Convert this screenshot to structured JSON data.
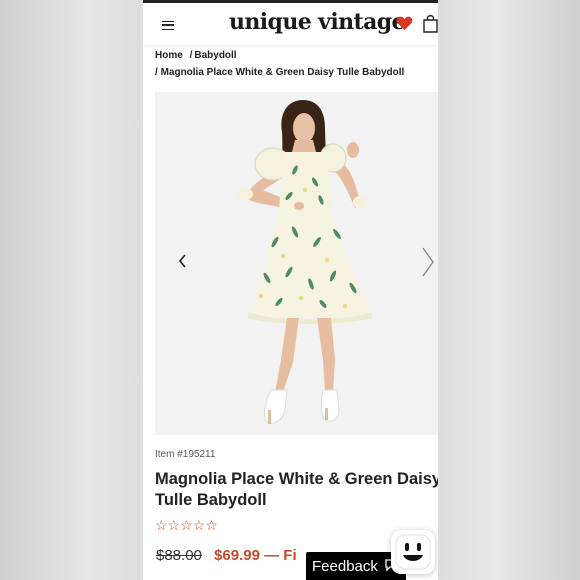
{
  "header": {
    "logo_text": "unique vintage",
    "menu_icon": "hamburger-menu-icon",
    "wishlist_icon": "heart-icon",
    "cart_icon": "shopping-bag-icon"
  },
  "breadcrumb": {
    "home": "Home",
    "sep1": "/",
    "category": "Babydoll",
    "sep2": "/",
    "product": "Magnolia Place White & Green Daisy Tulle Babydoll"
  },
  "gallery": {
    "prev_icon": "chevron-left-icon",
    "next_icon": "chevron-right-icon"
  },
  "product": {
    "item_number": "Item #195211",
    "title_line1": "Magnolia Place White & Green Daisy",
    "title_line2": "Tulle Babydoll",
    "rating_stars": "☆☆☆☆☆",
    "original_price": "$88.00",
    "sale_price": "$69.99 — Fi"
  },
  "widgets": {
    "feedback_label": "Feedback",
    "assistant_icon": "chat-bot-icon"
  },
  "colors": {
    "accent": "#c74a2a",
    "wishlist": "#d93a1f",
    "text": "#222222"
  }
}
